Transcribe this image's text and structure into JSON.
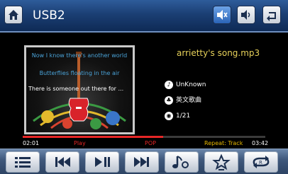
{
  "header": {
    "title": "USB2"
  },
  "lyrics": [
    "Now I know there's another world",
    "Butterflies floating in the air",
    "There is someone out there for ..."
  ],
  "track": {
    "filename": "arrietty's song.mp3",
    "artist": "UnKnown",
    "album": "英文歌曲",
    "index": "1/21"
  },
  "progress": {
    "fraction": 0.58
  },
  "status": {
    "elapsed": "02:01",
    "state": "Play",
    "genre": "POP",
    "repeat": "Repeat: Track",
    "total": "03:42"
  },
  "icons": {
    "home": "home-icon",
    "mute": "mute-icon",
    "volume": "volume-icon",
    "back": "back-icon",
    "playlist": "list-icon",
    "previous": "previous-icon",
    "play_pause": "play-pause-icon",
    "next": "next-icon",
    "music": "music-note-icon",
    "favorite": "star-icon",
    "repeat": "repeat-icon"
  },
  "colors": {
    "accent_red": "#e62626",
    "song_title": "#e8d25a",
    "status_yellow": "#e8b800",
    "lyric_blue": "#4aa3d8"
  }
}
